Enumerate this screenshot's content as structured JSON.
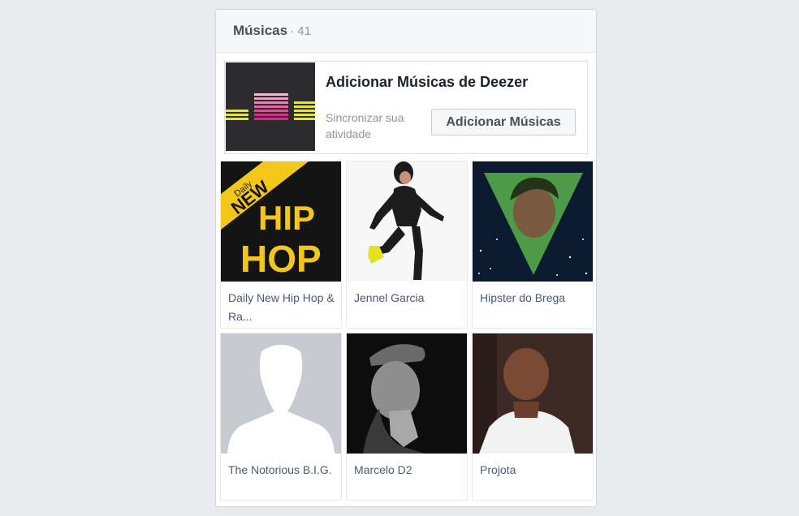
{
  "section": {
    "title": "Músicas",
    "count": "· 41"
  },
  "deezer": {
    "title": "Adicionar Músicas de Deezer",
    "subtitle": "Sincronizar sua atividade",
    "button_label": "Adicionar Músicas"
  },
  "tiles": [
    {
      "label": "Daily New Hip Hop & Ra...",
      "image_text": {
        "badge_small": "Daily",
        "badge": "NEW",
        "line1": "HIP",
        "line2": "HOP"
      }
    },
    {
      "label": "Jennel Garcia"
    },
    {
      "label": "Hipster do Brega"
    },
    {
      "label": "The Notorious B.I.G."
    },
    {
      "label": "Marcelo D2"
    },
    {
      "label": "Projota"
    }
  ],
  "colors": {
    "deezer_pink": "#e6258b",
    "deezer_yellow": "#e8e62a",
    "hiphop_yellow": "#f3c61a",
    "link_text": "#4b5a76"
  }
}
